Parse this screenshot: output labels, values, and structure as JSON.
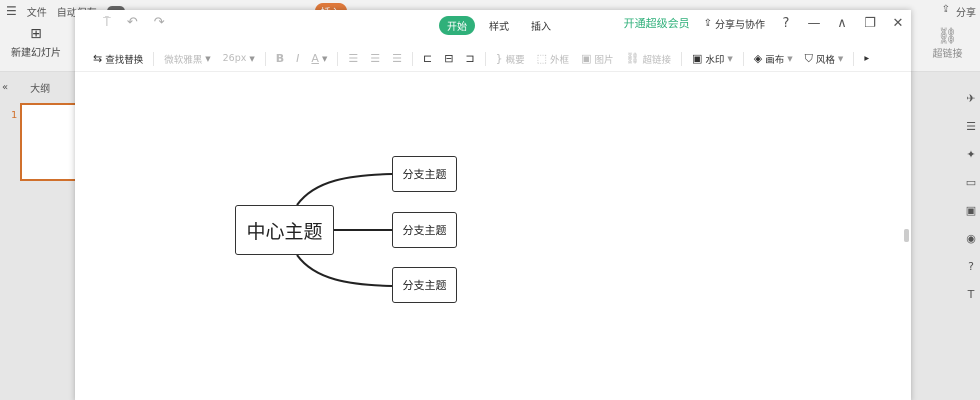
{
  "host": {
    "menubar": {
      "hamburger": "☰",
      "file": "文件",
      "autosave": "自动保存",
      "tab_highlight": "插入"
    },
    "new_slide": "新建幻灯片",
    "outline_label": "大纲",
    "slide_number": "1",
    "right_top_label": "超链接",
    "top_right_share": "分享"
  },
  "dialog": {
    "tabs": [
      {
        "label": "开始",
        "active": true
      },
      {
        "label": "样式",
        "active": false
      },
      {
        "label": "插入",
        "active": false
      }
    ],
    "vip_link": "开通超级会员",
    "share_collab": "分享与协作",
    "toolbar": {
      "find_replace": "查找替换",
      "font_family": "微软雅黑",
      "font_size": "26px",
      "bold": "B",
      "italic": "I",
      "font_color": "A",
      "summary": "概要",
      "outer_frame": "外框",
      "image": "图片",
      "hyperlink": "超链接",
      "watermark": "水印",
      "canvas": "画布",
      "style": "风格"
    }
  },
  "mindmap": {
    "central": "中心主题",
    "branches": [
      "分支主题",
      "分支主题",
      "分支主题"
    ]
  },
  "colors": {
    "accent": "#2fb07a",
    "host_accent": "#d0702c"
  }
}
